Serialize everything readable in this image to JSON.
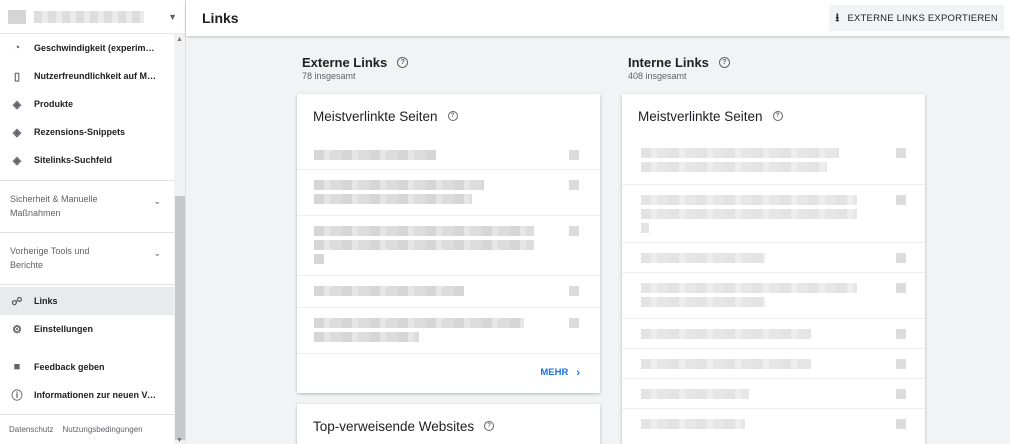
{
  "header": {
    "title": "Links",
    "export_label": "EXTERNE LINKS EXPORTIEREN"
  },
  "sidebar": {
    "items_top": [
      {
        "label": "Geschwindigkeit (experiment…",
        "icon": "speedometer-icon",
        "glyph": "◔"
      },
      {
        "label": "Nutzerfreundlichkeit auf Mo…",
        "icon": "mobile-icon",
        "glyph": "▯"
      },
      {
        "label": "Produkte",
        "icon": "layers-icon",
        "glyph": "◈"
      },
      {
        "label": "Rezensions-Snippets",
        "icon": "layers-icon",
        "glyph": "◈"
      },
      {
        "label": "Sitelinks-Suchfeld",
        "icon": "layers-icon",
        "glyph": "◈"
      }
    ],
    "sections": [
      {
        "label_line1": "Sicherheit & Manuelle",
        "label_line2": "Maßnahmen"
      },
      {
        "label_line1": "Vorherige Tools und",
        "label_line2": "Berichte"
      }
    ],
    "items_bottom": [
      {
        "label": "Links",
        "icon": "sitemap-icon",
        "glyph": "☍",
        "active": true
      },
      {
        "label": "Einstellungen",
        "icon": "gear-icon",
        "glyph": "⚙"
      },
      {
        "label": "Feedback geben",
        "icon": "feedback-icon",
        "glyph": "■"
      },
      {
        "label": "Informationen zur neuen Ver…",
        "icon": "info-icon",
        "glyph": "ⓘ"
      }
    ],
    "footer": {
      "privacy": "Datenschutz",
      "terms": "Nutzungsbedingungen"
    }
  },
  "external": {
    "title": "Externe Links",
    "subtitle": "78 insgesamt",
    "card_title": "Meistverlinkte Seiten",
    "more_label": "MEHR",
    "card2_title": "Top-verweisende Websites"
  },
  "internal": {
    "title": "Interne Links",
    "subtitle": "408 insgesamt",
    "card_title": "Meistverlinkte Seiten"
  },
  "colors": {
    "accent": "#1a73e8",
    "text": "#202124",
    "muted": "#5f6368",
    "background": "#f1f3f4"
  }
}
